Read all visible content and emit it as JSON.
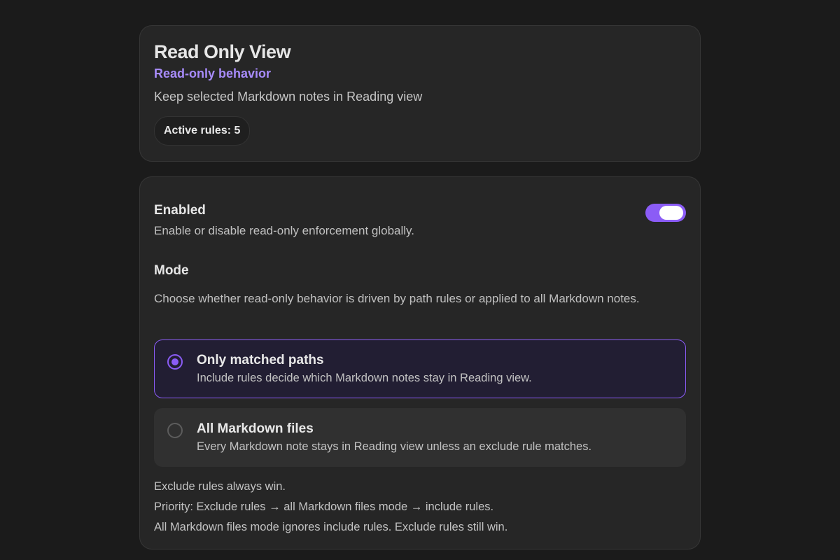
{
  "header": {
    "title": "Read Only View",
    "subtitle": "Read-only behavior",
    "description": "Keep selected Markdown notes in Reading view",
    "badge": "Active rules: 5"
  },
  "settings": {
    "enabled": {
      "name": "Enabled",
      "description": "Enable or disable read-only enforcement globally.",
      "value": true
    },
    "mode": {
      "name": "Mode",
      "description": "Choose whether read-only behavior is driven by path rules or applied to all Markdown notes.",
      "selected": "Only matched paths",
      "options": [
        {
          "title": "Only matched paths",
          "description": "Include rules decide which Markdown notes stay in Reading view."
        },
        {
          "title": "All Markdown files",
          "description": "Every Markdown note stays in Reading view unless an exclude rule matches."
        }
      ]
    },
    "notes": [
      "Exclude rules always win.",
      "Priority: Exclude rules → all Markdown files mode → include rules.",
      "All Markdown files mode ignores include rules. Exclude rules still win."
    ]
  },
  "colors": {
    "accent": "#8b5cf6",
    "subtitle": "#a78bfa",
    "background": "#1b1b1b",
    "card": "#262626"
  }
}
